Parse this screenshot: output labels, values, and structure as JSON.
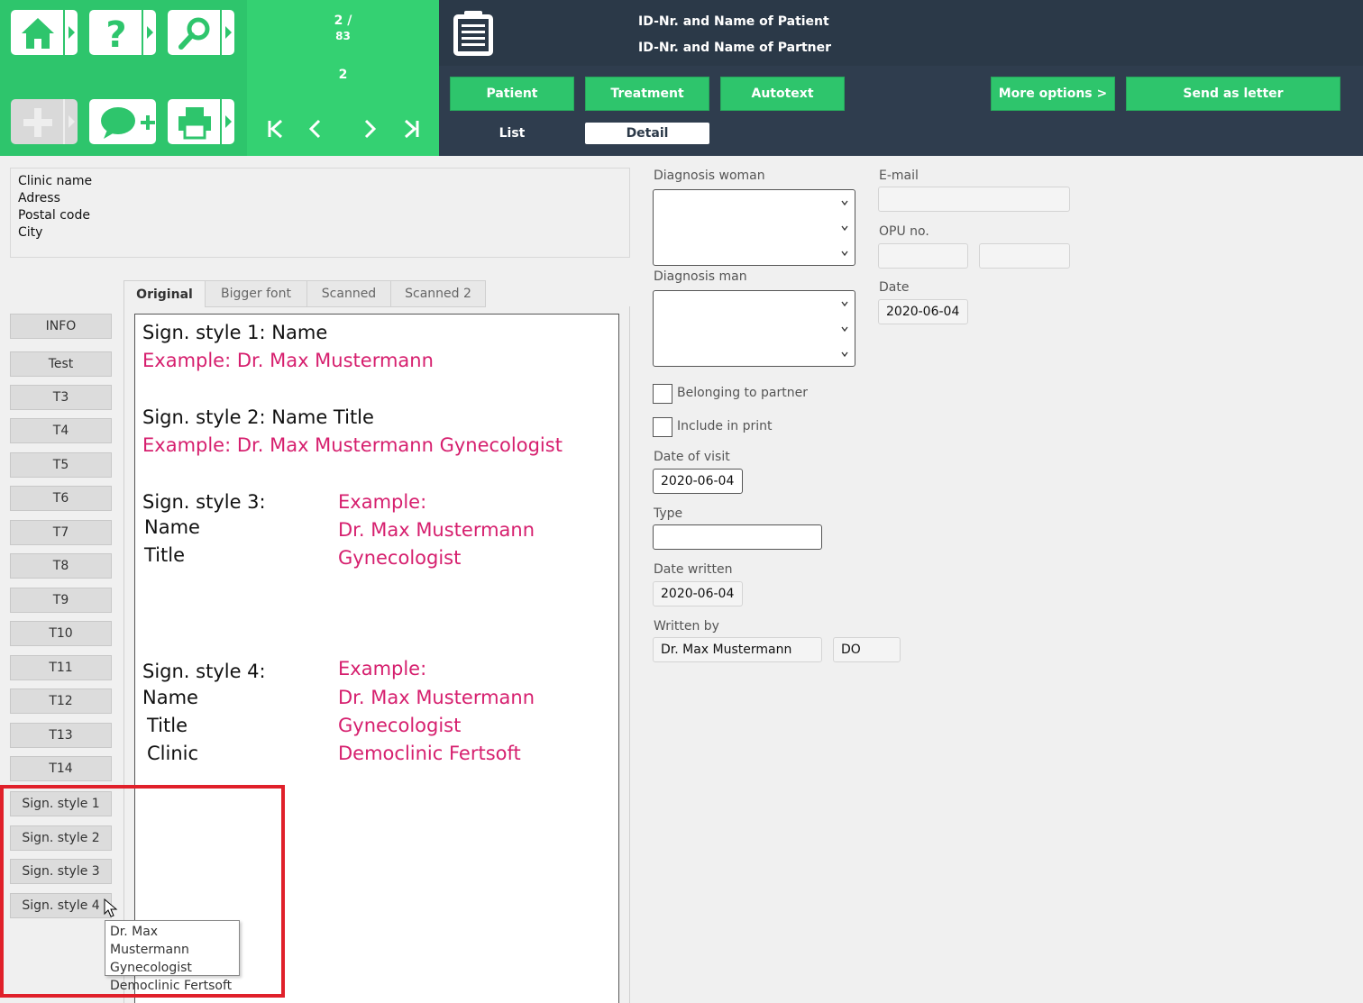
{
  "header": {
    "counter_top": "2 /",
    "counter_total": "83",
    "counter_current": "2",
    "patient_line": "ID-Nr. and Name of Patient",
    "partner_line": "ID-Nr. and Name of Partner",
    "nav": {
      "first": "|<",
      "prev": "<",
      "next": ">",
      "last": ">|"
    },
    "buttons": {
      "patient": "Patient",
      "treatment": "Treatment",
      "autotext": "Autotext",
      "more_options": "More options >",
      "send_as_letter": "Send as letter"
    },
    "subtabs": {
      "list": "List",
      "detail": "Detail"
    }
  },
  "address": [
    "Clinic name",
    "Adress",
    "Postal code",
    "City"
  ],
  "left_buttons": [
    "INFO",
    "Test",
    "T3",
    "T4",
    "T5",
    "T6",
    "T7",
    "T8",
    "T9",
    "T10",
    "T11",
    "T12",
    "T13",
    "T14",
    "Sign. style 1",
    "Sign. style 2",
    "Sign. style 3",
    "Sign. style 4"
  ],
  "tabs": [
    "Original",
    "Bigger font",
    "Scanned",
    "Scanned 2"
  ],
  "editor": {
    "s1_title": "Sign. style 1: Name",
    "s1_example": "Example: Dr. Max Mustermann",
    "s2_title": "Sign. style 2: Name Title",
    "s2_example": "Example: Dr. Max Mustermann Gynecologist",
    "s3_title": "Sign. style 3:",
    "s3_name": "Name",
    "s3_titleword": "Title",
    "s3_example": "Example:",
    "s3_ex_name": "Dr. Max Mustermann",
    "s3_ex_title": "Gynecologist",
    "s4_title": "Sign. style 4:",
    "s4_name": "Name",
    "s4_titleword": "Title",
    "s4_clinic": "Clinic",
    "s4_example": "Example:",
    "s4_ex_name": "Dr. Max Mustermann",
    "s4_ex_title": "Gynecologist",
    "s4_ex_clinic": "Democlinic Fertsoft"
  },
  "tooltip": [
    "Dr. Max Mustermann",
    "Gynecologist",
    "Democlinic Fertsoft"
  ],
  "form": {
    "diagnosis_woman_label": "Diagnosis woman",
    "diagnosis_man_label": "Diagnosis man",
    "email_label": "E-mail",
    "email_value": "",
    "opu_label": "OPU no.",
    "date_label": "Date",
    "date_value": "2020-06-04",
    "belonging_to_partner": "Belonging to partner",
    "include_in_print": "Include in print",
    "date_of_visit_label": "Date of visit",
    "date_of_visit_value": "2020-06-04",
    "type_label": "Type",
    "type_value": "",
    "date_written_label": "Date written",
    "date_written_value": "2020-06-04",
    "written_by_label": "Written by",
    "written_by_value": "Dr. Max Mustermann",
    "written_by_initials": "DO"
  },
  "colors": {
    "accent_green": "#2ec56c",
    "header_dark": "#2f3d4e",
    "example_pink": "#d61f6e",
    "highlight_red": "#e0202a"
  }
}
